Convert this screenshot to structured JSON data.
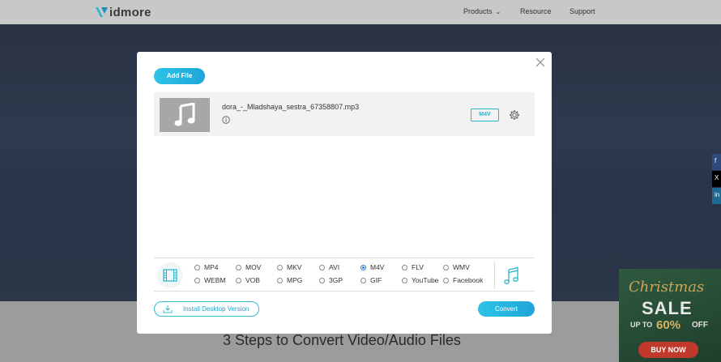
{
  "site": {
    "logo_text": "idmore",
    "nav": {
      "products": "Products",
      "resource": "Resource",
      "support": "Support"
    },
    "steps_title": "3 Steps to Convert Video/Audio Files",
    "social": {
      "facebook": "f",
      "x": "X",
      "linkedin": "in"
    }
  },
  "ad": {
    "script": "Christmas",
    "sale": "SALE",
    "up_to": "UP TO",
    "percent": "60%",
    "off": "OFF",
    "button": "BUY NOW"
  },
  "modal": {
    "add_file_label": "Add File",
    "file": {
      "name": "dora_-_Mladshaya_sestra_67358807.mp3",
      "format": "M4V"
    },
    "formats_row1": [
      "MP4",
      "MOV",
      "MKV",
      "AVI",
      "M4V",
      "FLV",
      "WMV"
    ],
    "formats_row2": [
      "WEBM",
      "VOB",
      "MPG",
      "3GP",
      "GIF",
      "YouTube",
      "Facebook"
    ],
    "selected_format": "M4V",
    "install_label": "Install Desktop Version",
    "convert_label": "Convert"
  },
  "colors": {
    "accent": "#1fa5d8",
    "accent_light": "#2bc4e6",
    "selected_radio": "#2b7fd8"
  }
}
